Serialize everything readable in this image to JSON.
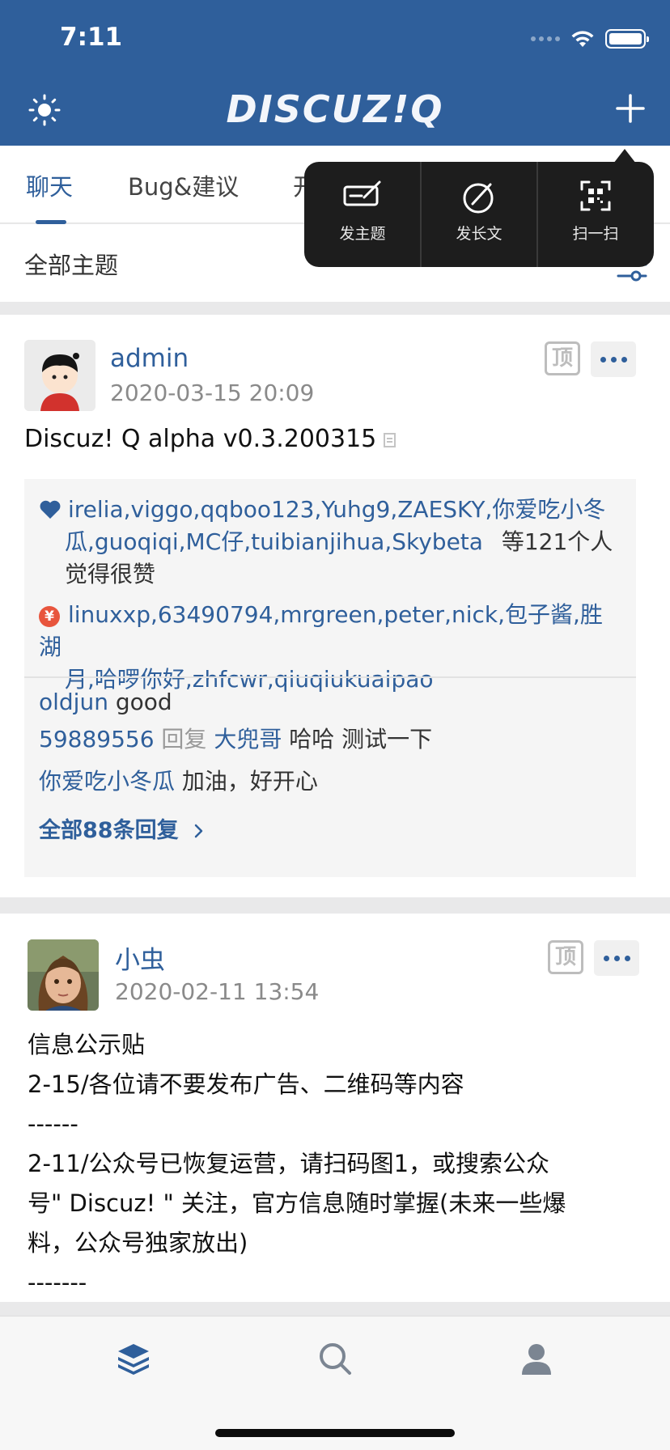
{
  "status_bar": {
    "time": "7:11"
  },
  "header": {
    "logo_text": "DISCUZ!Q"
  },
  "tabs": [
    {
      "label": "聊天",
      "active": true
    },
    {
      "label": "Bug&建议",
      "active": false
    },
    {
      "label": "开",
      "active": false
    }
  ],
  "filter": {
    "label": "全部主题"
  },
  "popup_menu": {
    "items": [
      {
        "label": "发主题",
        "icon": "edit-icon"
      },
      {
        "label": "发长文",
        "icon": "compose-icon"
      },
      {
        "label": "扫一扫",
        "icon": "scan-qr-icon"
      }
    ]
  },
  "posts": [
    {
      "username": "admin",
      "time": "2020-03-15 20:09",
      "top_badge": "顶",
      "title": "Discuz! Q alpha v0.3.200315",
      "likes": {
        "names_line1": "irelia,viggo,qqboo123,Yuhg9,ZAESKY,你爱吃小冬",
        "names_line2": "瓜,guoqiqi,MC仔,tuibianjihua,Skybeta",
        "suffix_inline": "等121个人",
        "suffix_line3": "觉得很赞"
      },
      "rewards": {
        "names_line1": "linuxxp,63490794,mrgreen,peter,nick,包子酱,胜湖",
        "names_line2": "月,哈啰你好,zhfcwr,qiuqiukuaipao"
      },
      "replies": [
        {
          "user": "oldjun",
          "text": "good"
        },
        {
          "user": "59889556",
          "reply_word": "回复",
          "target": "大兜哥",
          "text": "哈哈 测试一下"
        },
        {
          "user": "你爱吃小冬瓜",
          "text": "加油，好开心"
        }
      ],
      "all_replies_label": "全部88条回复"
    },
    {
      "username": "小虫",
      "time": "2020-02-11 13:54",
      "top_badge": "顶",
      "body_lines": [
        "信息公示贴",
        "2-15/各位请不要发布广告、二维码等内容",
        "------",
        "2-11/公众号已恢复运营，请扫码图1，或搜索公众",
        "号\" Discuz! \" 关注，官方信息随时掌握(未来一些爆",
        "料，公众号独家放出)",
        "-------"
      ]
    }
  ],
  "tabbar": [
    {
      "icon": "layers-icon",
      "active": true
    },
    {
      "icon": "search-icon",
      "active": false
    },
    {
      "icon": "user-icon",
      "active": false
    }
  ],
  "colors": {
    "brand": "#2f5f9b",
    "popup_bg": "#1d1d1d",
    "reward": "#e8553d"
  }
}
